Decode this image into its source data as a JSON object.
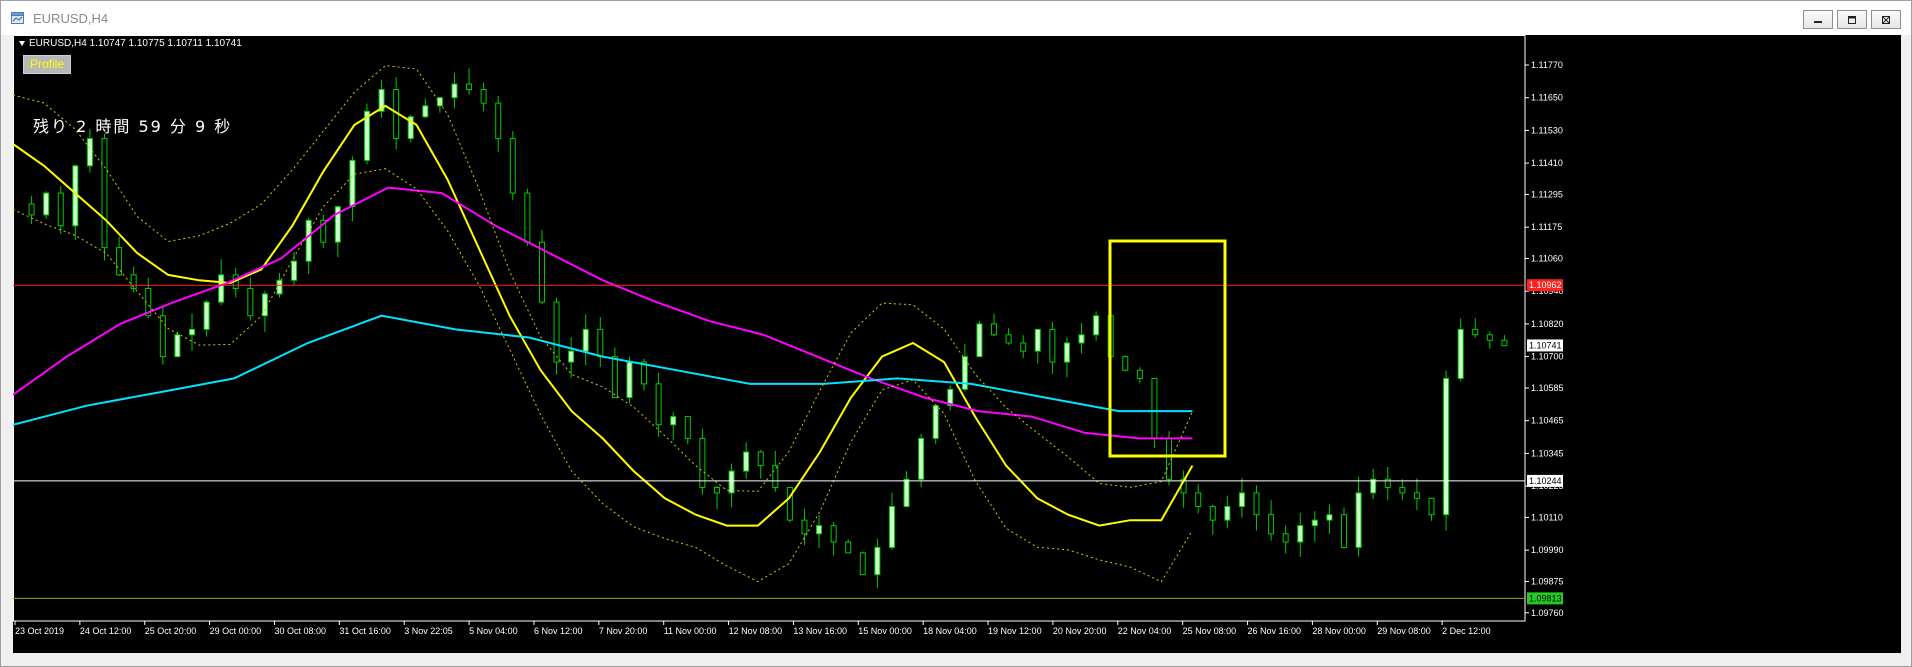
{
  "window": {
    "title": "EURUSD,H4",
    "buttons": [
      "minimize",
      "restore",
      "close"
    ]
  },
  "header": {
    "symbol_info": "EURUSD,H4  1.10747 1.10775 1.10711 1.10741",
    "profile_label": "Profile",
    "countdown": "残り 2 時間 59 分 9 秒"
  },
  "colors": {
    "background": "#000000",
    "candle_up": "#ccffcc",
    "candle_outline": "#00cc00",
    "ma_fast": "#ffff00",
    "ma_mid": "#ff00ff",
    "ma_slow": "#00e5ff",
    "bollinger": "#cccc00",
    "resistance_line": "#ff2020",
    "support_line_white": "#ffffff",
    "support_line_green": "#a0a000",
    "highlight_box": "#ffff00"
  },
  "price_labels": {
    "current": "1.10741",
    "red_line": "1.10962",
    "white_line": "1.10244",
    "green_line": "1.09813"
  },
  "chart_data": {
    "type": "candlestick",
    "title": "",
    "ylim": [
      1.0973,
      1.1188
    ],
    "y_ticks": [
      "1.11770",
      "1.11650",
      "1.11530",
      "1.11410",
      "1.11295",
      "1.11175",
      "1.11060",
      "1.10940",
      "1.10820",
      "1.10700",
      "1.10585",
      "1.10465",
      "1.10345",
      "1.10225",
      "1.10110",
      "1.09990",
      "1.09875",
      "1.09760"
    ],
    "x_ticks": [
      "23 Oct 2019",
      "24 Oct 12:00",
      "25 Oct 20:00",
      "29 Oct 00:00",
      "30 Oct 08:00",
      "31 Oct 16:00",
      "3 Nov 22:05",
      "5 Nov 04:00",
      "6 Nov 12:00",
      "7 Nov 20:00",
      "11 Nov 00:00",
      "12 Nov 08:00",
      "13 Nov 16:00",
      "15 Nov 00:00",
      "18 Nov 04:00",
      "19 Nov 12:00",
      "20 Nov 20:00",
      "22 Nov 04:00",
      "25 Nov 08:00",
      "26 Nov 16:00",
      "28 Nov 00:00",
      "29 Nov 08:00",
      "2 Dec 12:00"
    ],
    "close_path": [
      1.1126,
      1.1122,
      1.113,
      1.1118,
      1.114,
      1.115,
      1.111,
      1.11,
      1.1095,
      1.1085,
      1.107,
      1.1078,
      1.108,
      1.109,
      1.11,
      1.1095,
      1.1085,
      1.1093,
      1.1098,
      1.1105,
      1.112,
      1.1112,
      1.1125,
      1.1142,
      1.116,
      1.1168,
      1.115,
      1.1158,
      1.1162,
      1.1165,
      1.117,
      1.1168,
      1.1163,
      1.115,
      1.113,
      1.1112,
      1.109,
      1.1068,
      1.1072,
      1.108,
      1.107,
      1.1055,
      1.1068,
      1.106,
      1.1045,
      1.1048,
      1.104,
      1.1022,
      1.102,
      1.1028,
      1.1035,
      1.103,
      1.1022,
      1.101,
      1.1005,
      1.1008,
      1.1002,
      1.0998,
      1.099,
      1.1,
      1.1015,
      1.1025,
      1.104,
      1.1052,
      1.1058,
      1.107,
      1.1082,
      1.1078,
      1.1075,
      1.1072,
      1.108,
      1.1068,
      1.1075,
      1.1078,
      1.1085,
      1.107,
      1.1065,
      1.1062,
      1.104,
      1.1025,
      1.102,
      1.1015,
      1.101,
      1.1015,
      1.102,
      1.1012,
      1.1005,
      1.1002,
      1.1008,
      1.101,
      1.1012,
      1.1,
      1.102,
      1.1025,
      1.1022,
      1.102,
      1.1018,
      1.1012,
      1.1062,
      1.108,
      1.1078,
      1.1076,
      1.1074
    ],
    "series": [
      {
        "name": "MA fast",
        "color": "#ffff00",
        "values": [
          1.1148,
          1.114,
          1.113,
          1.112,
          1.1108,
          1.11,
          1.1098,
          1.1097,
          1.1102,
          1.1118,
          1.1138,
          1.1155,
          1.1162,
          1.1155,
          1.1135,
          1.111,
          1.1085,
          1.1065,
          1.105,
          1.104,
          1.1028,
          1.1018,
          1.1012,
          1.1008,
          1.1008,
          1.1018,
          1.1035,
          1.1055,
          1.107,
          1.1075,
          1.1068,
          1.1048,
          1.103,
          1.1018,
          1.1012,
          1.1008,
          1.101,
          1.101,
          1.103
        ]
      },
      {
        "name": "MA mid",
        "color": "#ff00ff",
        "values": [
          1.1056,
          1.107,
          1.1082,
          1.109,
          1.1097,
          1.1106,
          1.1122,
          1.1132,
          1.113,
          1.1118,
          1.1108,
          1.1098,
          1.109,
          1.1083,
          1.1078,
          1.107,
          1.1062,
          1.1055,
          1.105,
          1.1048,
          1.1042,
          1.104,
          1.104
        ]
      },
      {
        "name": "MA slow",
        "color": "#00e5ff",
        "values": [
          1.1045,
          1.1052,
          1.1057,
          1.1062,
          1.1075,
          1.1085,
          1.108,
          1.1077,
          1.107,
          1.1065,
          1.106,
          1.106,
          1.1062,
          1.106,
          1.1055,
          1.105,
          1.105
        ]
      }
    ],
    "resistance_price": 1.10962,
    "support_price_white": 1.10244,
    "support_price_green": 1.09813,
    "grid": false,
    "legend": "none"
  }
}
